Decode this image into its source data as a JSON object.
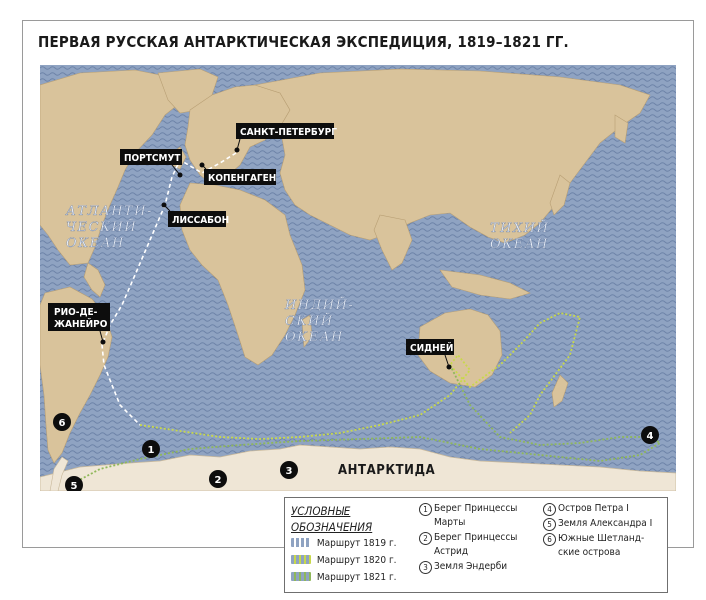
{
  "title": "ПЕРВАЯ РУССКАЯ АНТАРКТИЧЕСКАЯ ЭКСПЕДИЦИЯ, 1819–1821 ГГ.",
  "ports": {
    "saint_petersburg": "САНКТ-ПЕТЕРБУРГ",
    "portsmouth": "ПОРТСМУТ",
    "copenhagen": "КОПЕНГАГЕН",
    "lisbon": "ЛИССАБОН",
    "rio_line1": "РИО-ДЕ-",
    "rio_line2": "ЖАНЕЙРО",
    "sydney": "СИДНЕЙ"
  },
  "antarctica_label": "АНТАРКТИДА",
  "oceans": {
    "atlantic_line1": "АТЛАНТИ-",
    "atlantic_line2": "ЧЕСКИЙ",
    "atlantic_line3": "ОКЕАН",
    "indian_line1": "ИНДИЙ-",
    "indian_line2": "СКИЙ",
    "indian_line3": "ОКЕАН",
    "pacific_line1": "ТИХИЙ",
    "pacific_line2": "ОКЕАН"
  },
  "markers": [
    "1",
    "2",
    "3",
    "4",
    "5",
    "6"
  ],
  "legend": {
    "header_line1": "УСЛОВНЫЕ",
    "header_line2": "ОБОЗНАЧЕНИЯ",
    "routes": [
      {
        "label": "Маршрут 1819 г.",
        "color": "#ffffff"
      },
      {
        "label": "Маршрут 1820 г.",
        "color": "#c8d84a"
      },
      {
        "label": "Маршрут 1821 г.",
        "color": "#8fb85a"
      }
    ],
    "places": [
      {
        "num": "1",
        "line1": "Берег Принцессы",
        "line2": "Марты"
      },
      {
        "num": "2",
        "line1": "Берег Принцессы",
        "line2": "Астрид"
      },
      {
        "num": "3",
        "line1": "Земля Эндерби",
        "line2": ""
      },
      {
        "num": "4",
        "line1": "Остров Петра I",
        "line2": ""
      },
      {
        "num": "5",
        "line1": "Земля Александра I",
        "line2": ""
      },
      {
        "num": "6",
        "line1": "Южные Шетланд-",
        "line2": "ские острова"
      }
    ]
  },
  "colors": {
    "ocean": "#8fa3c2",
    "land": "#d9c39b",
    "antarctica": "#efe6d6",
    "route_1819": "#ffffff",
    "route_1820": "#c8d84a",
    "route_1821": "#8fb85a",
    "label_bg": "#0d0d0d"
  }
}
